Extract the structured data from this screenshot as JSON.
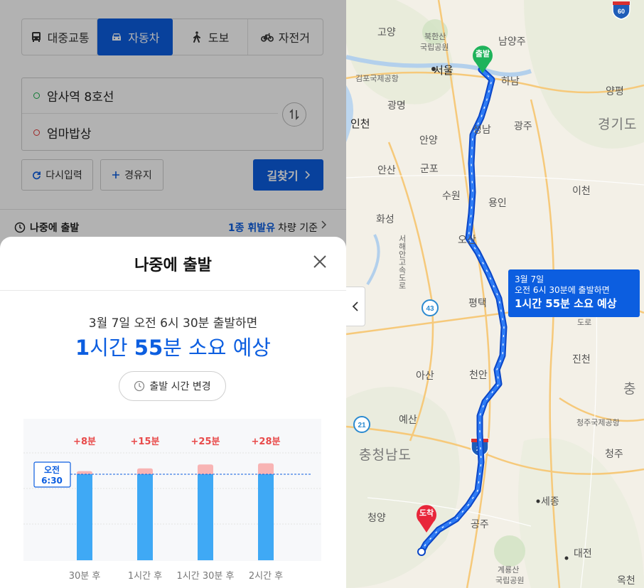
{
  "modes": [
    {
      "label": "대중교통",
      "icon": "bus-icon",
      "active": false
    },
    {
      "label": "자동차",
      "icon": "car-icon",
      "active": true
    },
    {
      "label": "도보",
      "icon": "walk-icon",
      "active": false
    },
    {
      "label": "자전거",
      "icon": "bicycle-icon",
      "active": false
    }
  ],
  "route": {
    "origin": "암사역 8호선",
    "destination": "엄마밥상"
  },
  "buttons": {
    "reset": "다시입력",
    "waypoint": "경유지",
    "search": "길찾기"
  },
  "depart_row": {
    "label": "나중에 출발",
    "fuel_highlight": "1종 휘발유",
    "fuel_suffix": "차량 기준"
  },
  "modal": {
    "title": "나중에 출발",
    "summary": "3월 7일 오전 6시 30분 출발하면",
    "duration_hours_num": "1",
    "duration_hours_unit": "시간 ",
    "duration_min_num": "55",
    "duration_min_unit": "분",
    "duration_suffix": " 소요 예상",
    "change_time": "출발 시간 변경"
  },
  "chart_data": {
    "type": "bar",
    "baseline_label": [
      "오전",
      "6:30"
    ],
    "categories": [
      "30분 후",
      "1시간 후",
      "1시간 30분 후",
      "2시간 후"
    ],
    "extra_labels": [
      "+8분",
      "+15분",
      "+25분",
      "+28분"
    ],
    "extra_minutes": [
      8,
      15,
      25,
      28
    ],
    "baseline_minutes": 115,
    "colors": {
      "base": "#3fa9f5",
      "extra": "#f8b4b4",
      "extra_text": "#e84a4a",
      "baseline": "#0c5ee0"
    }
  },
  "map": {
    "places": [
      {
        "name": "고양",
        "cls": ""
      },
      {
        "name": "북한산",
        "cls": "small"
      },
      {
        "name": "국립공원",
        "cls": "small"
      },
      {
        "name": "남양주",
        "cls": ""
      },
      {
        "name": "서울",
        "cls": "city"
      },
      {
        "name": "김포국제공항",
        "cls": "small"
      },
      {
        "name": "하남",
        "cls": ""
      },
      {
        "name": "양평",
        "cls": ""
      },
      {
        "name": "광명",
        "cls": ""
      },
      {
        "name": "인천",
        "cls": "city"
      },
      {
        "name": "성남",
        "cls": ""
      },
      {
        "name": "광주",
        "cls": ""
      },
      {
        "name": "경기도",
        "cls": "big"
      },
      {
        "name": "안양",
        "cls": ""
      },
      {
        "name": "안산",
        "cls": ""
      },
      {
        "name": "군포",
        "cls": ""
      },
      {
        "name": "수원",
        "cls": ""
      },
      {
        "name": "용인",
        "cls": ""
      },
      {
        "name": "이천",
        "cls": ""
      },
      {
        "name": "화성",
        "cls": ""
      },
      {
        "name": "오산",
        "cls": ""
      },
      {
        "name": "평택",
        "cls": ""
      },
      {
        "name": "서해안고속도로",
        "cls": "small"
      },
      {
        "name": "진천",
        "cls": ""
      },
      {
        "name": "아산",
        "cls": ""
      },
      {
        "name": "천안",
        "cls": ""
      },
      {
        "name": "충",
        "cls": "big"
      },
      {
        "name": "청주국제공항",
        "cls": "small"
      },
      {
        "name": "예산",
        "cls": ""
      },
      {
        "name": "충청남도",
        "cls": "big"
      },
      {
        "name": "청주",
        "cls": ""
      },
      {
        "name": "세종",
        "cls": ""
      },
      {
        "name": "청양",
        "cls": ""
      },
      {
        "name": "공주",
        "cls": ""
      },
      {
        "name": "대전",
        "cls": ""
      },
      {
        "name": "계룡산",
        "cls": "small"
      },
      {
        "name": "국립공원",
        "cls": "small"
      },
      {
        "name": "옥천",
        "cls": ""
      },
      {
        "name": "도로",
        "cls": "small"
      }
    ],
    "highways": [
      "60",
      "43",
      "21",
      "25"
    ],
    "pins": {
      "start": "출발",
      "end": "도착"
    },
    "tooltip": {
      "line1": "3월 7일",
      "line2": "오전 6시 30분에 출발하면",
      "line3": "1시간 55분 소요 예상"
    }
  }
}
